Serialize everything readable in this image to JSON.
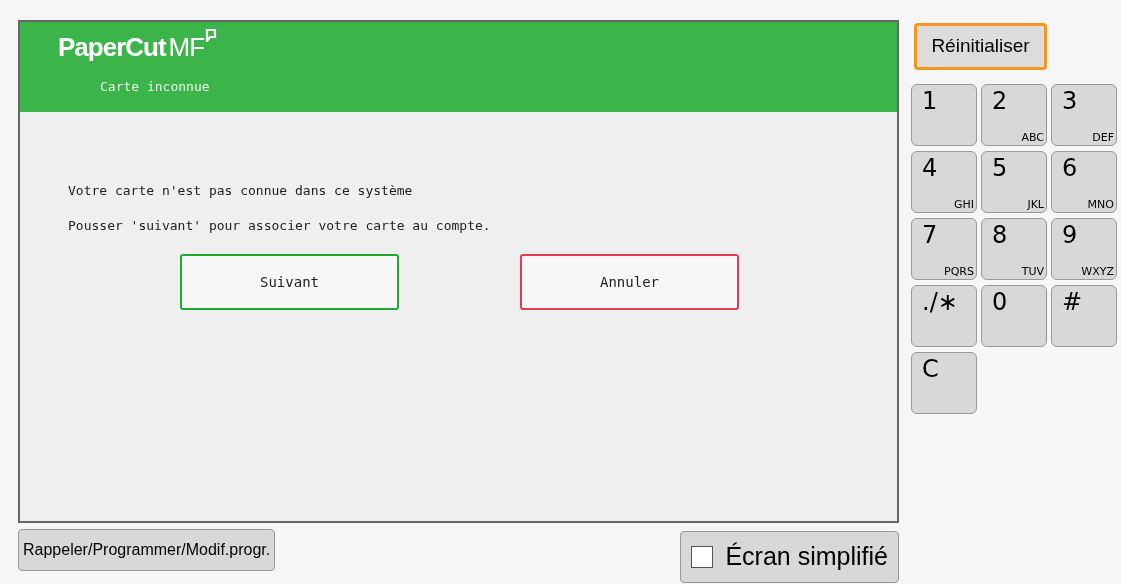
{
  "header": {
    "logo": "PaperCut",
    "logo_suffix": "MF",
    "subtitle": "Carte inconnue"
  },
  "messages": [
    "Votre carte n'est pas connue dans ce système",
    "Pousser 'suivant' pour associer votre carte au compte."
  ],
  "actions": [
    {
      "label": "Suivant",
      "kind": "confirm"
    },
    {
      "label": "Annuler",
      "kind": "cancel"
    }
  ],
  "reset_button": "Réinitialiser",
  "keypad": [
    {
      "key": "1"
    },
    {
      "key": "2",
      "letters": "ABC"
    },
    {
      "key": "3",
      "letters": "DEF"
    },
    {
      "key": "4",
      "letters": "GHI"
    },
    {
      "key": "5",
      "letters": "JKL"
    },
    {
      "key": "6",
      "letters": "MNO"
    },
    {
      "key": "7",
      "letters": "PQRS"
    },
    {
      "key": "8",
      "letters": "TUV"
    },
    {
      "key": "9",
      "letters": "WXYZ"
    },
    {
      "key": "./∗"
    },
    {
      "key": "0"
    },
    {
      "key": "#"
    },
    {
      "key": "C"
    }
  ],
  "program_button": "Rappeler/Programmer/Modif.progr.",
  "simplified_screen": {
    "label": "Écran simplifié",
    "checked": false
  }
}
